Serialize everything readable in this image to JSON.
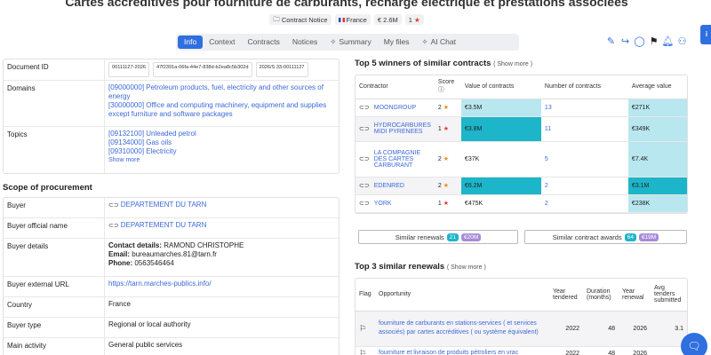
{
  "page": {
    "title": "Cartes accréditives pour fourniture de carburants, recharge électrique et prestations associées",
    "chips": {
      "notice": "Contract Notice",
      "country": "France",
      "value": "€ 2.6M",
      "stars": "1"
    }
  },
  "tabs": [
    "Info",
    "Context",
    "Contracts",
    "Notices",
    "Summary",
    "My files",
    "AI Chat"
  ],
  "side_button": "i",
  "details": {
    "document_id": {
      "label": "Document ID",
      "ids": [
        "00111127-2026",
        "47f2391a-06fa-44e7-838d-b2ea8c5b302d",
        "2026/S 33-00111127"
      ]
    },
    "domains": {
      "label": "Domains",
      "items": [
        "[09000000] Petroleum products, fuel, electricity and other sources of energy",
        "[30000000] Office and computing machinery, equipment and supplies except furniture and software packages"
      ]
    },
    "topics": {
      "label": "Topics",
      "items": [
        "[09132100] Unleaded petrol",
        "[09134000] Gas oils",
        "[09310000] Electricity"
      ],
      "show_more": "Show more"
    }
  },
  "scope": {
    "title": "Scope of procurement",
    "buyer": {
      "label": "Buyer",
      "value": "DEPARTEMENT DU TARN"
    },
    "buyer_official": {
      "label": "Buyer official name",
      "value": "DEPARTEMENT DU TARN"
    },
    "buyer_details": {
      "label": "Buyer details",
      "contact_key": "Contact details:",
      "contact_val": "RAMOND CHRISTOPHE",
      "email_key": "Email:",
      "email_val": "bureaumarches.81@tarn.fr",
      "phone_key": "Phone:",
      "phone_val": "0563546464"
    },
    "buyer_url": {
      "label": "Buyer external URL",
      "value": "https://tarn.marches-publics.info/"
    },
    "country": {
      "label": "Country",
      "value": "France"
    },
    "buyer_type": {
      "label": "Buyer type",
      "value": "Regional or local authority"
    },
    "main_activity": {
      "label": "Main activity",
      "value": "General public services"
    }
  },
  "winners": {
    "title": "Top 5 winners of similar contracts",
    "show_more": "( Show more )",
    "headers": {
      "contractor": "Contractor",
      "score": "Score",
      "value": "Value of contracts",
      "count": "Number of contracts",
      "avg": "Average value"
    },
    "rows": [
      {
        "name": "MOONGROUP",
        "score": "2",
        "value": "€3.5M",
        "count": "13",
        "avg": "€271K"
      },
      {
        "name": "HYDROCARBURES MIDI PYRENEES",
        "score": "1",
        "value": "€3.8M",
        "count": "11",
        "avg": "€349K"
      },
      {
        "name": "LA COMPAGNIE DES CARTES CARBURANT",
        "score": "2",
        "value": "€37K",
        "count": "5",
        "avg": "€7.4K"
      },
      {
        "name": "EDENRED",
        "score": "2",
        "value": "€6.2M",
        "count": "2",
        "avg": "€3.1M"
      },
      {
        "name": "YORK",
        "score": "1",
        "value": "€475K",
        "count": "2",
        "avg": "€238K"
      }
    ]
  },
  "similar": {
    "renewals_label": "Similar renewals",
    "renewals_count": "21",
    "renewals_value": "€20M",
    "awards_label": "Similar contract awards",
    "awards_count": "64",
    "awards_value": "€19M"
  },
  "renewals": {
    "title": "Top 3 similar renewals",
    "show_more": "( Show more )",
    "headers": {
      "flag": "Flag",
      "opportunity": "Opportunity",
      "year_tendered": "Year tendered",
      "duration": "Duration (months)",
      "year_renewal": "Year renewal",
      "avg_tenders": "Avg tenders submitted"
    },
    "rows": [
      {
        "opportunity": "fourniture de carburants en stations-services ( et services associés) par cartes accréditives ( ou système équivalent)",
        "year_tendered": "2022",
        "duration": "48",
        "year_renewal": "2026",
        "avg_tenders": "3.1"
      },
      {
        "opportunity": "fourniture et livraison de produits pétroliers en vrac",
        "year_tendered": "2022",
        "duration": "48",
        "year_renewal": "2026",
        "avg_tenders": ""
      }
    ]
  },
  "colors": {
    "accent": "#2f6fe0",
    "teal_dark": "#1cb5c9",
    "teal_light": "#b9e7ef",
    "link": "#3c69d8"
  }
}
